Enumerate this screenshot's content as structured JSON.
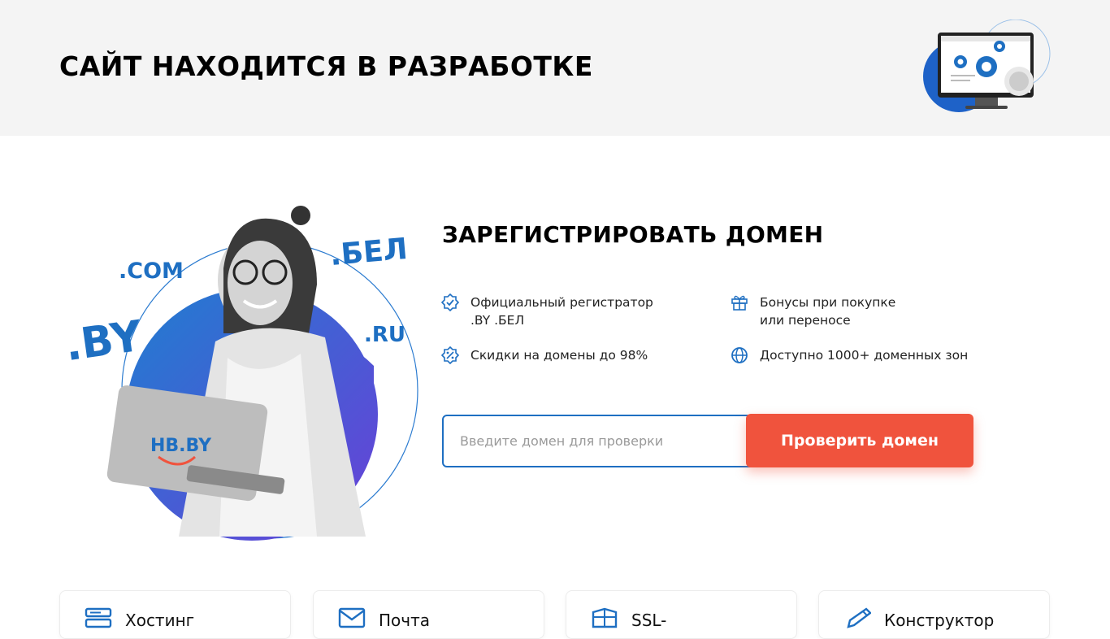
{
  "header": {
    "title": "САЙТ НАХОДИТСЯ В РАЗРАБОТКЕ",
    "illustration_icon": "monitor-gears-icon"
  },
  "hero": {
    "domains": {
      "com": ".COM",
      "bel": ".БЕЛ",
      "by": ".BY",
      "ru": ".RU"
    },
    "laptop_logo": "HB.BY"
  },
  "register": {
    "title": "ЗАРЕГИСТРИРОВАТЬ ДОМЕН",
    "features": [
      {
        "icon": "verified-badge-icon",
        "text": "Официальный регистратор\n.BY .БЕЛ"
      },
      {
        "icon": "gift-icon",
        "text": "Бонусы при покупке\nили переносе"
      },
      {
        "icon": "discount-badge-icon",
        "text": "Скидки на домены до 98%"
      },
      {
        "icon": "globe-icon",
        "text": "Доступно 1000+ доменных зон"
      }
    ],
    "search": {
      "placeholder": "Введите домен для проверки",
      "value": "",
      "button_label": "Проверить домен"
    }
  },
  "services": [
    {
      "icon": "server-icon",
      "label": "Хостинг"
    },
    {
      "icon": "mail-icon",
      "label": "Почта"
    },
    {
      "icon": "ssl-shield-icon",
      "label": "SSL-"
    },
    {
      "icon": "pencil-icon",
      "label": "Конструктор"
    }
  ],
  "colors": {
    "accent_blue": "#1e6fc2",
    "button_red": "#f0533d",
    "header_bg": "#f4f4f4"
  }
}
